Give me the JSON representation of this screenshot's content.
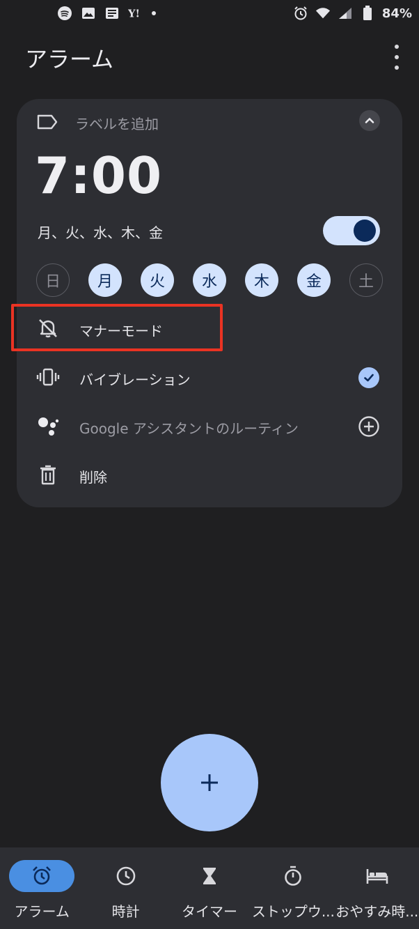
{
  "status_bar": {
    "battery_text": "84%",
    "left_icons": [
      "spotify-icon",
      "image-icon",
      "news-icon",
      "yahoo-icon",
      "dot-icon"
    ],
    "right_icons": [
      "alarm-clock-icon",
      "wifi-icon",
      "signal-icon",
      "battery-icon"
    ]
  },
  "header": {
    "title": "アラーム"
  },
  "alarm_card": {
    "label_placeholder": "ラベルを追加",
    "time": "7:00",
    "repeat_summary": "月、火、水、木、金",
    "enabled": true,
    "days": [
      {
        "label": "日",
        "selected": false
      },
      {
        "label": "月",
        "selected": true
      },
      {
        "label": "火",
        "selected": true
      },
      {
        "label": "水",
        "selected": true
      },
      {
        "label": "木",
        "selected": true
      },
      {
        "label": "金",
        "selected": true
      },
      {
        "label": "土",
        "selected": false
      }
    ],
    "silent_mode_label": "マナーモード",
    "vibration_label": "バイブレーション",
    "vibration_checked": true,
    "assistant_label": "Google アシスタントのルーティン",
    "delete_label": "削除"
  },
  "fab": {
    "icon": "plus-icon"
  },
  "bottom_nav": {
    "items": [
      {
        "label": "アラーム",
        "icon": "alarm-icon",
        "active": true
      },
      {
        "label": "時計",
        "icon": "clock-icon",
        "active": false
      },
      {
        "label": "タイマー",
        "icon": "hourglass-icon",
        "active": false
      },
      {
        "label": "ストップウ...",
        "icon": "stopwatch-icon",
        "active": false
      },
      {
        "label": "おやすみ時...",
        "icon": "bed-icon",
        "active": false
      }
    ]
  },
  "colors": {
    "background": "#1f1f21",
    "card": "#2d2e33",
    "accent": "#a8c7fa",
    "highlight_box": "#ea3323"
  }
}
